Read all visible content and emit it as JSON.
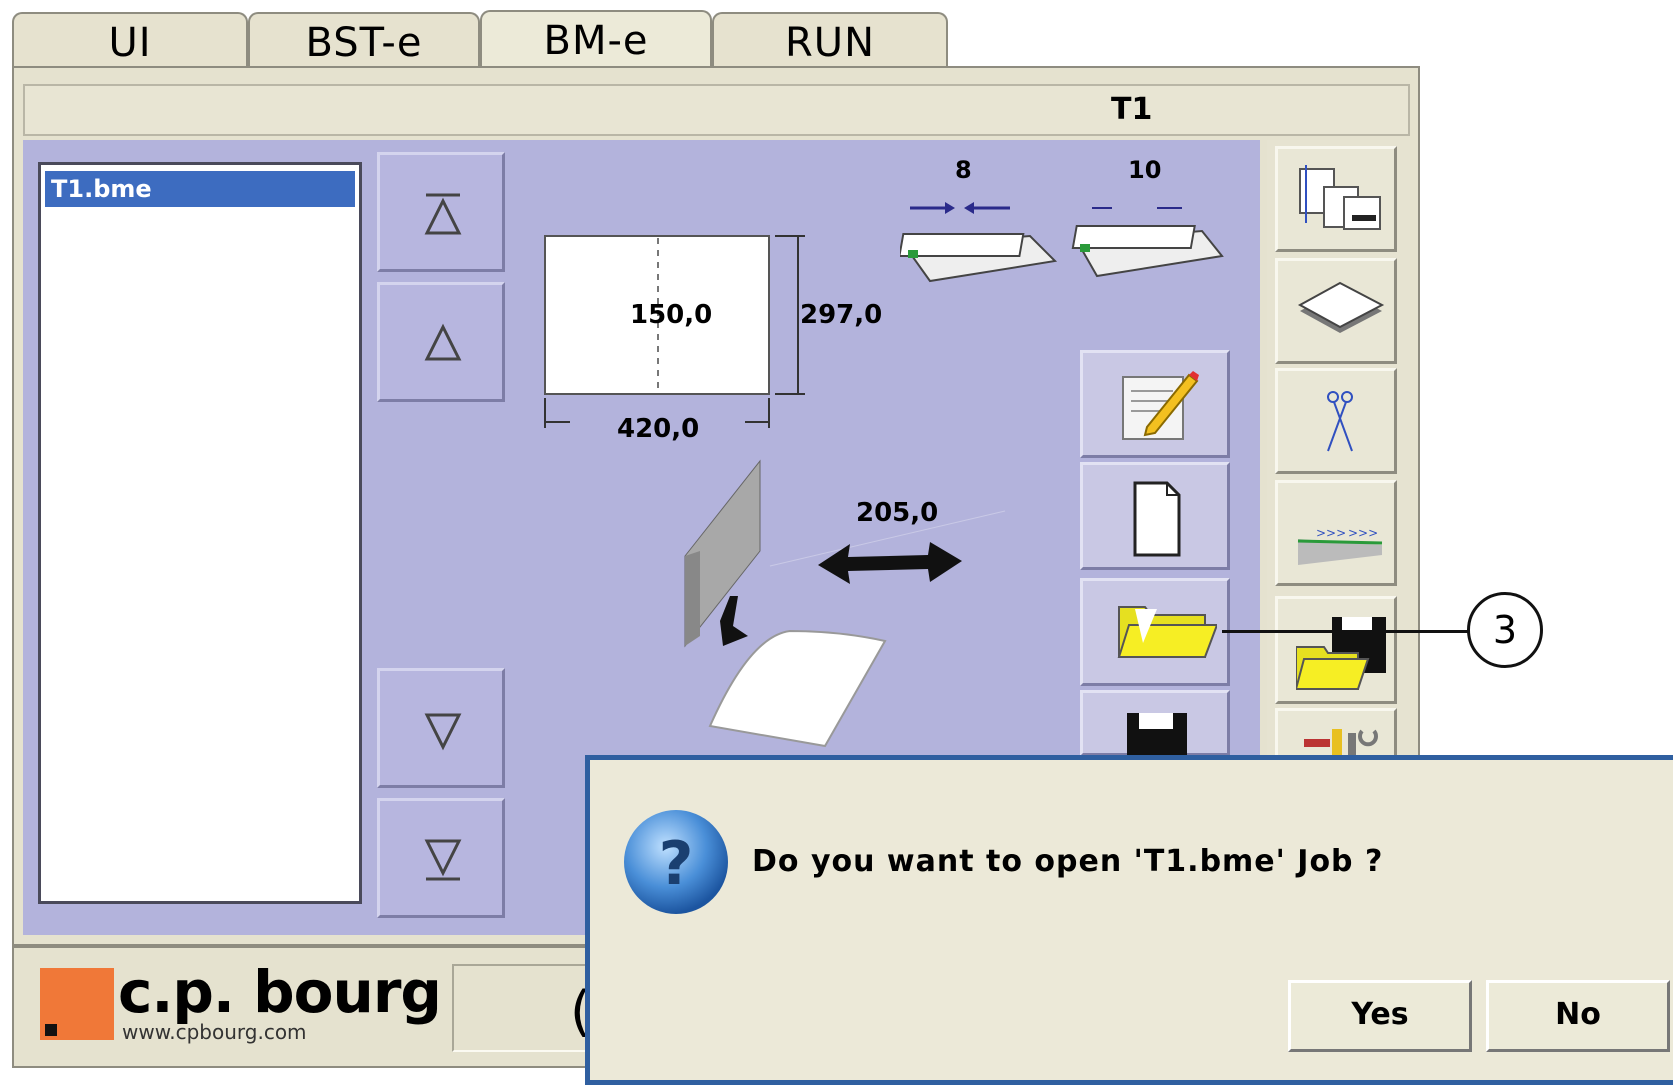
{
  "tabs": [
    {
      "label": "UI"
    },
    {
      "label": "BST-e"
    },
    {
      "label": "BM-e",
      "active": true
    },
    {
      "label": "RUN"
    }
  ],
  "header": {
    "title": "T1"
  },
  "job_list": {
    "selected_item": "T1.bme"
  },
  "diagram": {
    "inner_width": "150,0",
    "height": "297,0",
    "width": "420,0",
    "left_count": "8",
    "right_count": "10",
    "length": "205,0"
  },
  "callout": {
    "number": "3"
  },
  "footer": {
    "logo_text": "c.p. bourg",
    "logo_url": "www.cpbourg.com",
    "partial_char": "("
  },
  "dialog": {
    "message": "Do you want to open 'T1.bme' Job ?",
    "yes_label": "Yes",
    "no_label": "No"
  },
  "colors": {
    "workspace": "#b3b3dc",
    "selection": "#3d6cc0",
    "dialog_border": "#2f5fa0",
    "logo_orange": "#f07838"
  },
  "icons": [
    "scroll-top-icon",
    "scroll-up-icon",
    "scroll-down-icon",
    "scroll-bottom-icon",
    "edit-job-icon",
    "new-job-icon",
    "open-folder-icon",
    "save-icon",
    "layout-icon",
    "sheet-icon",
    "scissors-icon",
    "folding-icon",
    "open-save-icon",
    "tools-icon",
    "question-icon"
  ]
}
